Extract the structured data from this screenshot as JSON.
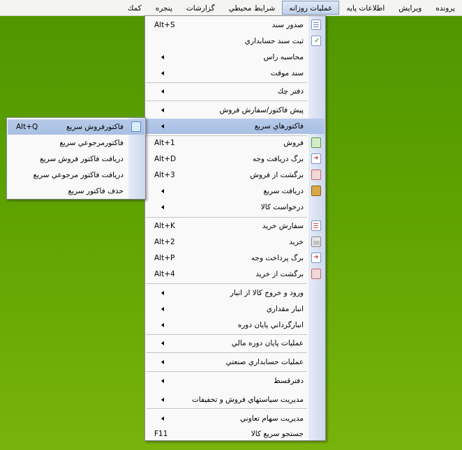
{
  "menubar": {
    "items": [
      {
        "label": "پرونده"
      },
      {
        "label": "ويرايش"
      },
      {
        "label": "اطلاعات پايه"
      },
      {
        "label": "عمليات روزانه"
      },
      {
        "label": "شرايط محيطي"
      },
      {
        "label": "گزارشات"
      },
      {
        "label": "پنجره"
      },
      {
        "label": "كمك"
      }
    ],
    "active": "عمليات روزانه"
  },
  "main_menu": {
    "items": [
      {
        "label": "صدور سند",
        "shortcut": "Alt+S",
        "icon": "document-icon"
      },
      {
        "label": "ثبت سند حسابداري",
        "shortcut": "",
        "icon": "document-check-icon"
      },
      {
        "label": "محاسبه راس",
        "shortcut": "",
        "icon": ""
      },
      {
        "label": "سند موقت",
        "shortcut": "",
        "icon": ""
      },
      {
        "label": "دفتر چك",
        "shortcut": "",
        "icon": ""
      },
      {
        "label": "پيش فاكتور/سفارش فروش",
        "shortcut": "",
        "icon": ""
      },
      {
        "label": "فاكتورهاي سريع",
        "shortcut": "",
        "icon": ""
      },
      {
        "label": "فروش",
        "shortcut": "Alt+1",
        "icon": "basket-green-icon"
      },
      {
        "label": "برگ دريافت وجه",
        "shortcut": "Alt+D",
        "icon": "document-arrow-icon"
      },
      {
        "label": "برگشت از فروش",
        "shortcut": "Alt+3",
        "icon": "basket-return-icon"
      },
      {
        "label": "دريافت سريع",
        "shortcut": "",
        "icon": "coin-icon"
      },
      {
        "label": "درخواست كالا",
        "shortcut": "",
        "icon": ""
      },
      {
        "label": "سفارش خريد",
        "shortcut": "Alt+K",
        "icon": "checklist-icon"
      },
      {
        "label": "خريد",
        "shortcut": "Alt+2",
        "icon": "basket-icon"
      },
      {
        "label": "برگ پرداخت وجه",
        "shortcut": "Alt+P",
        "icon": "document-arrow-icon"
      },
      {
        "label": "برگشت از خريد",
        "shortcut": "Alt+4",
        "icon": "basket-red-icon"
      },
      {
        "label": "ورود و خروج كالا از انبار",
        "shortcut": "",
        "icon": ""
      },
      {
        "label": "انبار مقداري",
        "shortcut": "",
        "icon": ""
      },
      {
        "label": "انبارگرداني پايان دوره",
        "shortcut": "",
        "icon": ""
      },
      {
        "label": "عمليات پايان دوره مالي",
        "shortcut": "",
        "icon": ""
      },
      {
        "label": "عمليات حسابداري صنعتي",
        "shortcut": "",
        "icon": ""
      },
      {
        "label": "دفترقسط",
        "shortcut": "",
        "icon": ""
      },
      {
        "label": "مديريت سياستهاي فروش و تخفيفات",
        "shortcut": "",
        "icon": ""
      },
      {
        "label": "مديريت سهام تعاوني",
        "shortcut": "",
        "icon": ""
      },
      {
        "label": "جستجو سريع كالا",
        "shortcut": "F11",
        "icon": ""
      }
    ]
  },
  "submenu": {
    "items": [
      {
        "label": "فاكتورفروش سريع",
        "shortcut": "Alt+Q",
        "icon": "invoice-icon"
      },
      {
        "label": "فاكتورمرجوعي سريع",
        "shortcut": ""
      },
      {
        "label": "دريافت فاكتور فروش سريع",
        "shortcut": ""
      },
      {
        "label": "دريافت فاكتور مرجوعي سريع",
        "shortcut": ""
      },
      {
        "label": "حذف فاكتور سريع",
        "shortcut": ""
      }
    ]
  }
}
